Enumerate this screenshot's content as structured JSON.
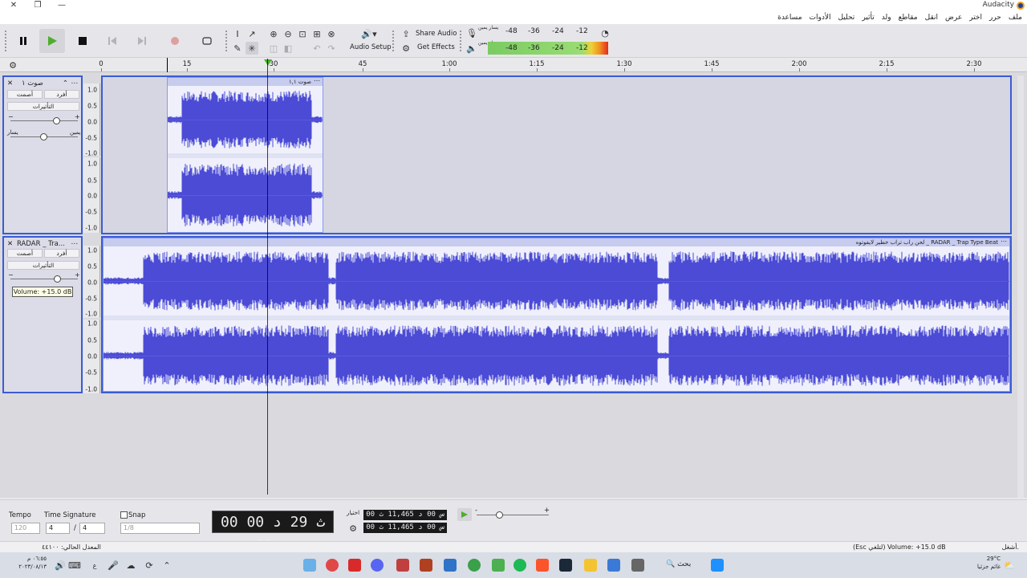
{
  "window": {
    "title": "Audacity",
    "controls": [
      "✕",
      "❐",
      "—"
    ]
  },
  "menu": [
    "ملف",
    "حرر",
    "اختر",
    "عرض",
    "انقل",
    "مقاطع",
    "ولد",
    "تأثير",
    "تحليل",
    "الأدوات",
    "مساعدة"
  ],
  "toolbar": {
    "audio_setup": "Audio Setup",
    "share_audio": "Share Audio",
    "get_effects": "Get Effects",
    "meter_scale": [
      "-48",
      "-36",
      "-24",
      "-12"
    ],
    "rec_meter_label": "يسار يمين",
    "play_meter_label": "يسار يمين"
  },
  "ruler": {
    "ticks": [
      "0",
      "15",
      "30",
      "45",
      "1:00",
      "1:15",
      "1:30",
      "1:45",
      "2:00",
      "2:15",
      "2:30"
    ]
  },
  "tracks": [
    {
      "name": "صوت ١",
      "mute": "أصمت",
      "solo": "أفرد",
      "effects": "التأثيرات",
      "pan_left": "يسار",
      "pan_right": "يمين",
      "clip_title": "صوت ١,١",
      "scale": [
        "1.0",
        "0.5",
        "0.0",
        "-0.5",
        "-1.0"
      ]
    },
    {
      "name": "RADAR _ Tra...",
      "mute": "أصمت",
      "solo": "أفرد",
      "effects": "التأثيرات",
      "clip_title": "لحن راب تراب خطير لايفوتوه _ RADAR _ Trap Type Beat",
      "scale": [
        "1.0",
        "0.5",
        "0.0",
        "-0.5",
        "-1.0"
      ],
      "tooltip": "Volume: +15.0 dB"
    }
  ],
  "bottom": {
    "tempo_label": "Tempo",
    "tempo_value": "120",
    "time_sig_label": "Time Signature",
    "time_sig_num": "4",
    "time_sig_den": "4",
    "snap_label": "Snap",
    "snap_value": "1/8",
    "big_time": "00 ث 29 د 00 س 00",
    "selection_label": "اختيار",
    "sel_start": "00 س 00 د 11,465 ث",
    "sel_end": "00 س 00 د 11,465 ث"
  },
  "status": {
    "left": "المعدل الحالي: ٤٤١٠٠",
    "right": "(Esc لتلغي) Volume: +15.0 dB",
    "far_right": "أشغل."
  },
  "taskbar": {
    "weather_temp": "29°C",
    "weather_text": "غائم جزئيا",
    "search": "بحث",
    "time": "٠٦:٥٥ م",
    "date": "٢٠٢٣/٠٨/١٣"
  },
  "colors": {
    "accent": "#3a5bd6",
    "waveform": "#4b4bd6",
    "play_green": "#4cae2c",
    "record_red": "#d03030"
  }
}
